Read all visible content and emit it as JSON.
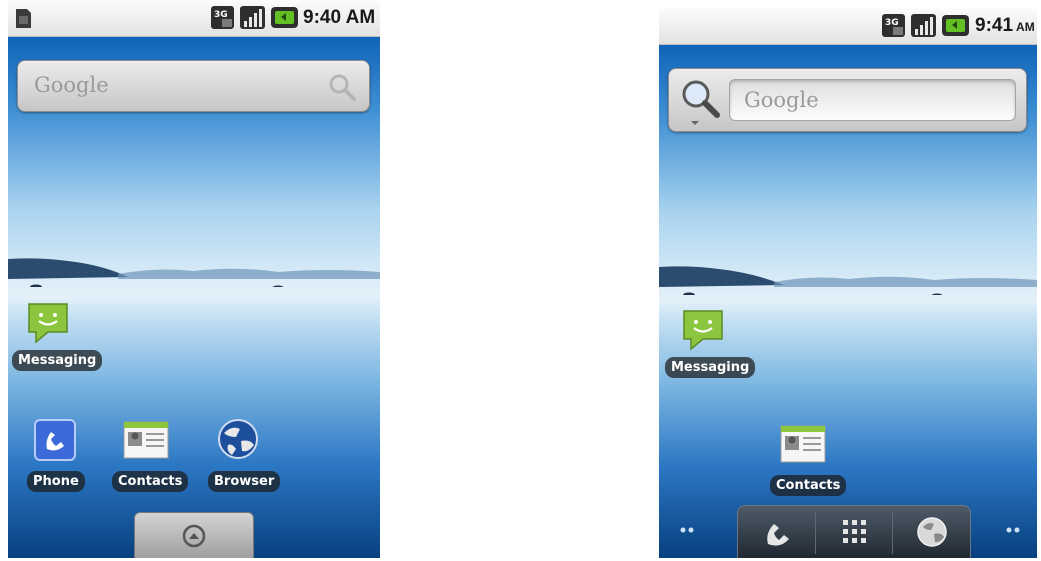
{
  "screens": [
    {
      "status_time": "9:40 AM",
      "network": "3G",
      "search_placeholder": "Google",
      "shortcuts": [
        "Messaging",
        "Phone",
        "Contacts",
        "Browser"
      ],
      "icons": [
        "sim-card-icon",
        "3g-icon",
        "signal-icon",
        "battery-icon",
        "search-icon",
        "messaging-icon",
        "phone-icon",
        "contacts-icon",
        "browser-icon",
        "launcher-icon"
      ]
    },
    {
      "status_time": "9:41",
      "status_time_suffix": "AM",
      "network": "3G",
      "search_placeholder": "Google",
      "shortcuts": [
        "Messaging",
        "Contacts"
      ],
      "dock": [
        "phone-icon",
        "all-apps-grid-icon",
        "browser-icon"
      ],
      "icons": [
        "3g-icon",
        "signal-icon",
        "battery-icon",
        "search-icon",
        "messaging-icon",
        "contacts-icon",
        "page-indicator-icon"
      ]
    }
  ],
  "colors": {
    "messaging_green": "#8cc63f",
    "wallpaper_top": "#0f63b8",
    "wallpaper_bottom": "#07407f"
  }
}
